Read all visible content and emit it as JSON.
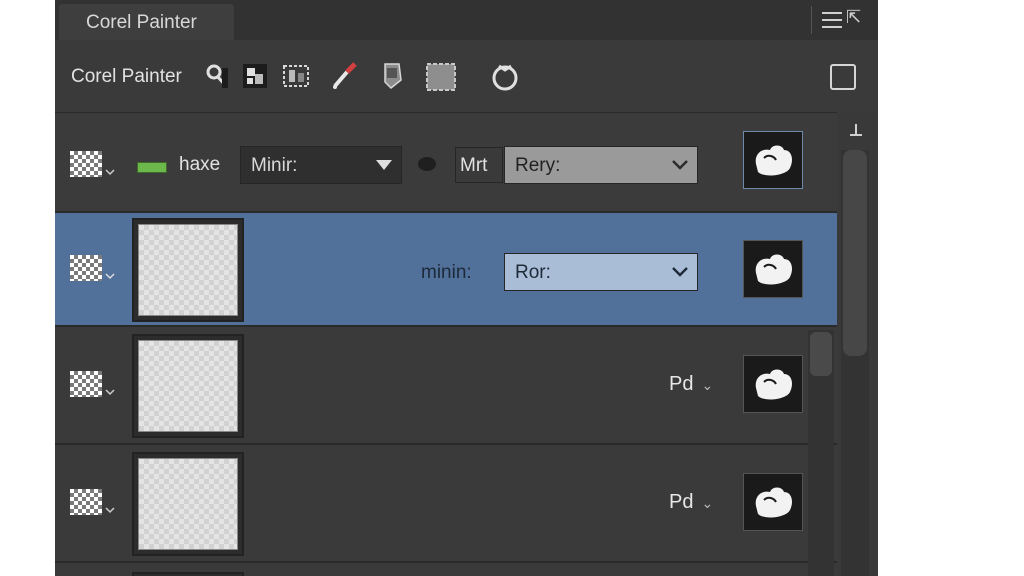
{
  "window": {
    "title": "Corel Painter"
  },
  "toolbar": {
    "app_label": "Corel Painter",
    "tools": [
      "pen-tool-icon",
      "layer-group-icon",
      "layer-adjust-icon",
      "dropper-brush-icon",
      "layer-transform-icon",
      "canvas-icon",
      "pour-icon"
    ]
  },
  "header_row": {
    "name": "haxe",
    "composite_method": "Minir:",
    "mrt_label": "Mrt",
    "blend_value": "Rery:"
  },
  "layers": [
    {
      "blend_label": "minin:",
      "blend_value": "Ror:",
      "selected": true
    },
    {
      "blend_label": "Pd",
      "selected": false
    },
    {
      "blend_label": "Pd",
      "selected": false
    }
  ],
  "colors": {
    "selected_row": "#51709a",
    "panel_bg": "#3b3b3b",
    "swatch_green": "#6cb84a"
  }
}
